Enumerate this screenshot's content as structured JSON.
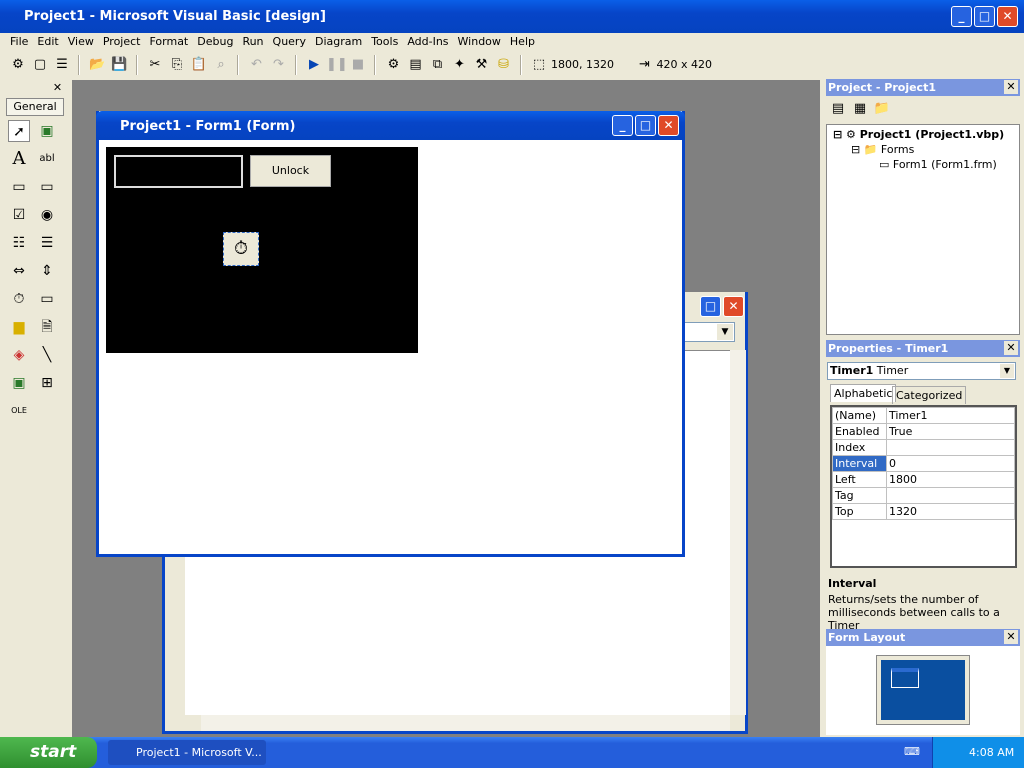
{
  "app": {
    "title": "Project1 - Microsoft Visual Basic [design]"
  },
  "menu": [
    "File",
    "Edit",
    "View",
    "Project",
    "Format",
    "Debug",
    "Run",
    "Query",
    "Diagram",
    "Tools",
    "Add-Ins",
    "Window",
    "Help"
  ],
  "toolbar": {
    "position": "1800, 1320",
    "size": "420 x 420"
  },
  "toolbox": {
    "tab": "General"
  },
  "form": {
    "title": "Project1 - Form1 (Form)",
    "unlock_label": "Unlock",
    "textbox_value": ""
  },
  "project": {
    "title": "Project - Project1",
    "root": "Project1 (Project1.vbp)",
    "folder": "Forms",
    "item": "Form1 (Form1.frm)"
  },
  "properties": {
    "title": "Properties - Timer1",
    "object": "Timer1",
    "object_type": "Timer",
    "tabs": [
      "Alphabetic",
      "Categorized"
    ],
    "rows": [
      {
        "name": "(Name)",
        "value": "Timer1"
      },
      {
        "name": "Enabled",
        "value": "True"
      },
      {
        "name": "Index",
        "value": ""
      },
      {
        "name": "Interval",
        "value": "0"
      },
      {
        "name": "Left",
        "value": "1800"
      },
      {
        "name": "Tag",
        "value": ""
      },
      {
        "name": "Top",
        "value": "1320"
      }
    ],
    "selected": "Interval",
    "desc_title": "Interval",
    "desc_text": "Returns/sets the number of milliseconds between calls to a Timer"
  },
  "form_layout": {
    "title": "Form Layout"
  },
  "taskbar": {
    "start": "start",
    "task": "Project1 - Microsoft V...",
    "clock": "4:08 AM"
  }
}
